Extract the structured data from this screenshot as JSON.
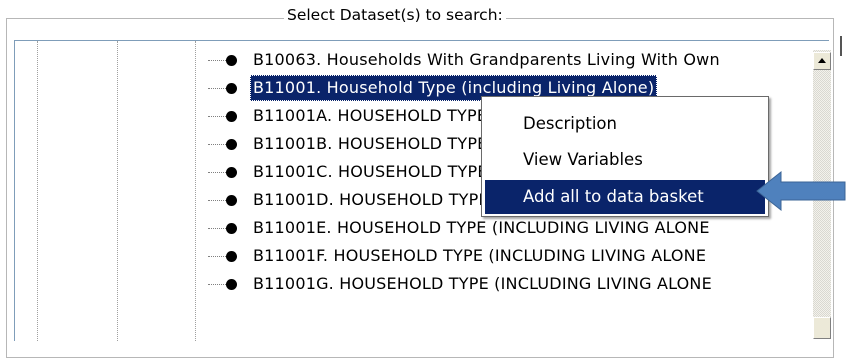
{
  "groupbox": {
    "title": "Select Dataset(s) to search:"
  },
  "tree": {
    "rows": [
      {
        "label": "B10063.  Households With Grandparents Living With Own",
        "selected": false
      },
      {
        "label": "B11001.  Household Type (including Living Alone)",
        "selected": true
      },
      {
        "label": "B11001A.  HOUSEHOLD TYPE (INCLUDING LIVING ALONE",
        "selected": false
      },
      {
        "label": "B11001B.  HOUSEHOLD TYPE (INCLUDING LIVING ALONE",
        "selected": false
      },
      {
        "label": "B11001C.  HOUSEHOLD TYPE (INCLUDING LIVING ALONE",
        "selected": false
      },
      {
        "label": "B11001D.  HOUSEHOLD TYPE (INCLUDING LIVING ALONE",
        "selected": false
      },
      {
        "label": "B11001E.  HOUSEHOLD TYPE (INCLUDING LIVING ALONE",
        "selected": false
      },
      {
        "label": "B11001F.  HOUSEHOLD TYPE (INCLUDING LIVING ALONE",
        "selected": false
      },
      {
        "label": "B11001G.  HOUSEHOLD TYPE (INCLUDING LIVING ALONE",
        "selected": false
      }
    ]
  },
  "context_menu": {
    "items": [
      {
        "label": "Description",
        "active": false
      },
      {
        "label": "View Variables",
        "active": false
      },
      {
        "label": "Add all to data basket",
        "active": true
      }
    ]
  },
  "colors": {
    "selection": "#0a246a",
    "annotation_arrow": "#4f81bd"
  }
}
